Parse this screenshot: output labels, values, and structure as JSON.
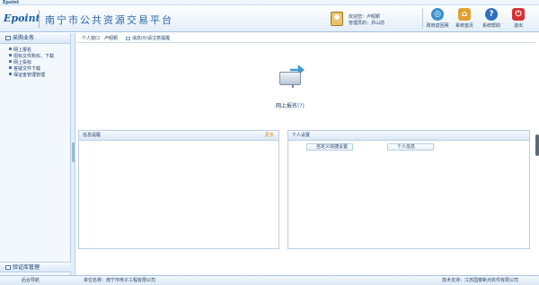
{
  "topstrip": {
    "brand": "Epoint"
  },
  "header": {
    "logo": "Epoint",
    "title": "南宁市公共资源交易平台",
    "user_line1": "欢迎您：卢昭颖",
    "user_line2": "管理员的：并山前",
    "buttons": [
      {
        "label": "政府返回网",
        "icon": "globe-icon",
        "color": "#3a8fd0"
      },
      {
        "label": "系统首页",
        "icon": "home-icon",
        "color": "#e0a030"
      },
      {
        "label": "系统帮助",
        "icon": "help-icon",
        "color": "#2f6fc0"
      },
      {
        "label": "退出",
        "icon": "power-icon",
        "color": "#d93030"
      }
    ]
  },
  "sidebar": {
    "title": "采购业务",
    "items": [
      "网上报名",
      "招标文件购买、下载",
      "网上投标",
      "答疑文件下载",
      "保证金管理管理"
    ],
    "bottom_title": "验证库管理"
  },
  "tabs": {
    "tab1": "个人窗口",
    "tab2": "卢昭颖",
    "tab3": "消息(0)请注意提醒"
  },
  "mail": {
    "label": "网上报名",
    "count": "(?)"
  },
  "panels": {
    "left_title": "信息提醒",
    "left_more": "更多",
    "right_title": "个人设置",
    "right_btn1": "自定义快捷设置",
    "right_btn2": "个人信息"
  },
  "footer": {
    "left": "后台导航",
    "mid": "单位名称：南宁市电子工程有限公司",
    "right": "技术支持：江苏国泰新点软件有限公司"
  }
}
